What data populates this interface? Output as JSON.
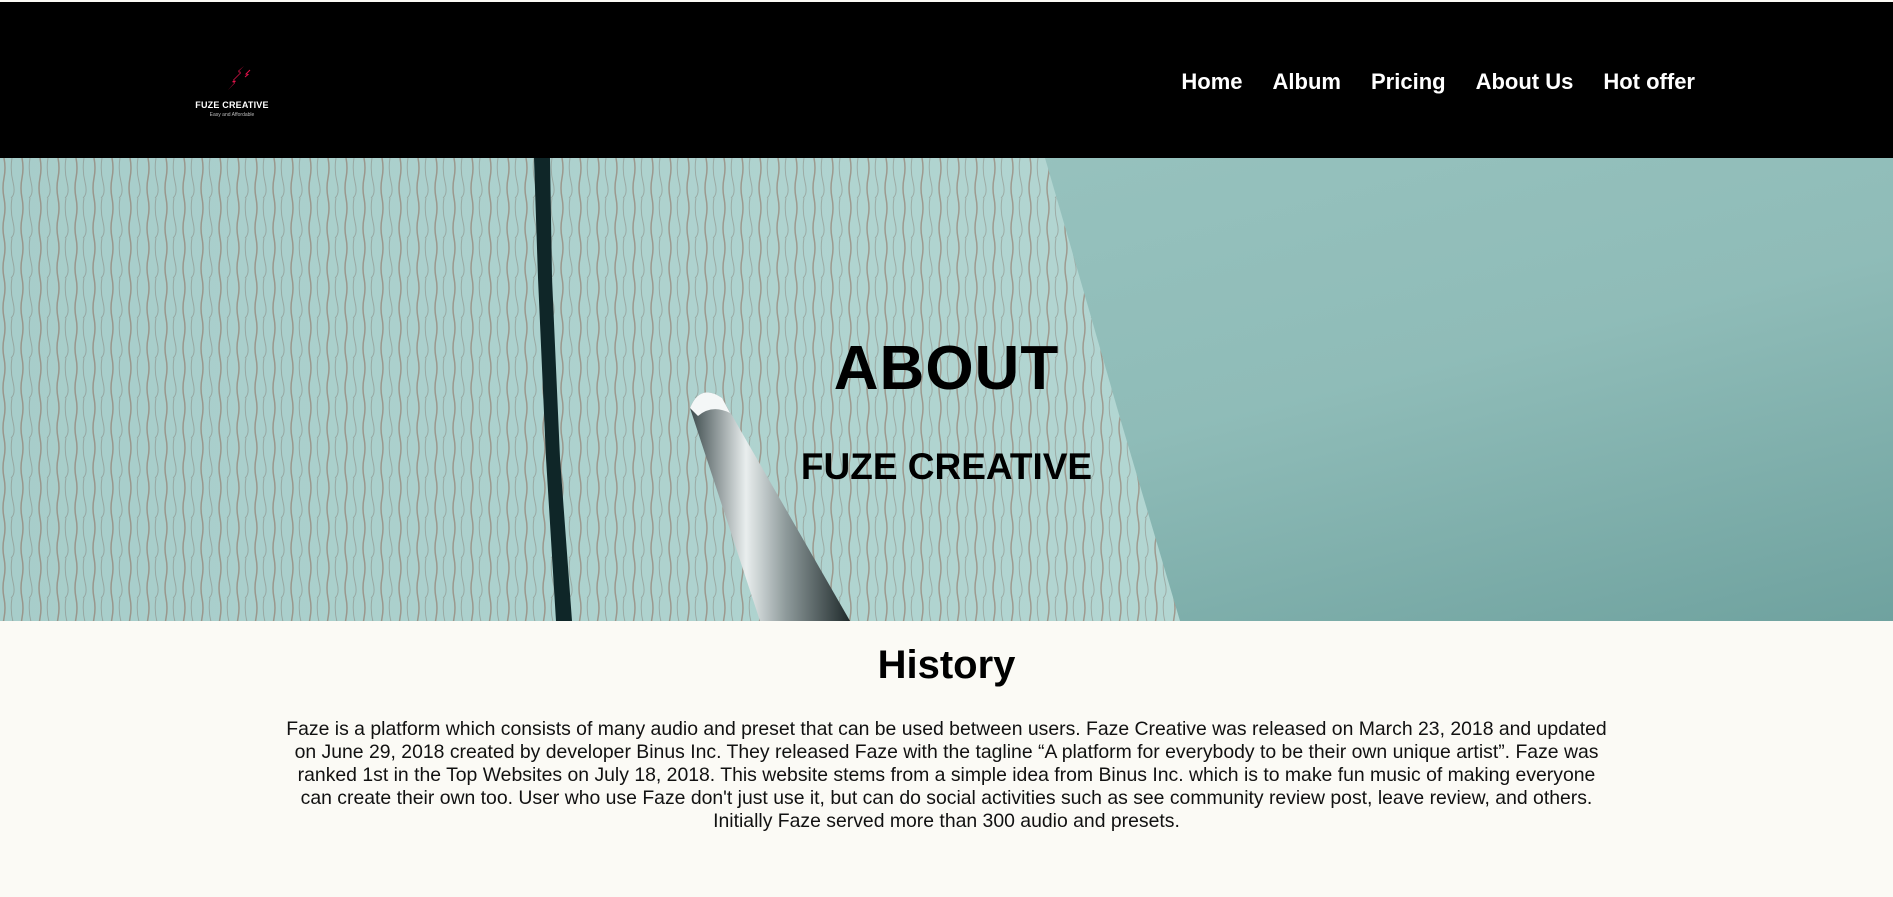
{
  "header": {
    "logo": {
      "title": "FUZE CREATIVE",
      "tagline": "Easy and Affordable",
      "icon": "lightning-bolt-icon",
      "accent_color": "#e0124a"
    },
    "nav": [
      {
        "label": "Home"
      },
      {
        "label": "Album"
      },
      {
        "label": "Pricing"
      },
      {
        "label": "About Us"
      },
      {
        "label": "Hot offer"
      }
    ]
  },
  "hero": {
    "title": "ABOUT",
    "subtitle": "FUZE CREATIVE",
    "background": "teal-wood-with-pen"
  },
  "history": {
    "title": "History",
    "body": "Faze is a platform which consists of many audio and preset that can be used between users. Faze Creative was released on March 23, 2018 and updated on June 29, 2018 created by developer Binus Inc. They released Faze with the tagline “A platform for everybody to be their own unique artist”. Faze was ranked 1st in the Top Websites on July 18, 2018. This website stems from a simple idea from Binus Inc. which is to make fun music of making everyone can create their own too. User who use Faze don't just use it, but can do social activities such as see community review post, leave review, and others. Initially Faze served more than 300 audio and presets."
  },
  "colors": {
    "nav_bg": "#000000",
    "nav_text": "#ffffff",
    "page_bg": "#fbfaf5",
    "hero_teal": "#9fc9c6"
  }
}
